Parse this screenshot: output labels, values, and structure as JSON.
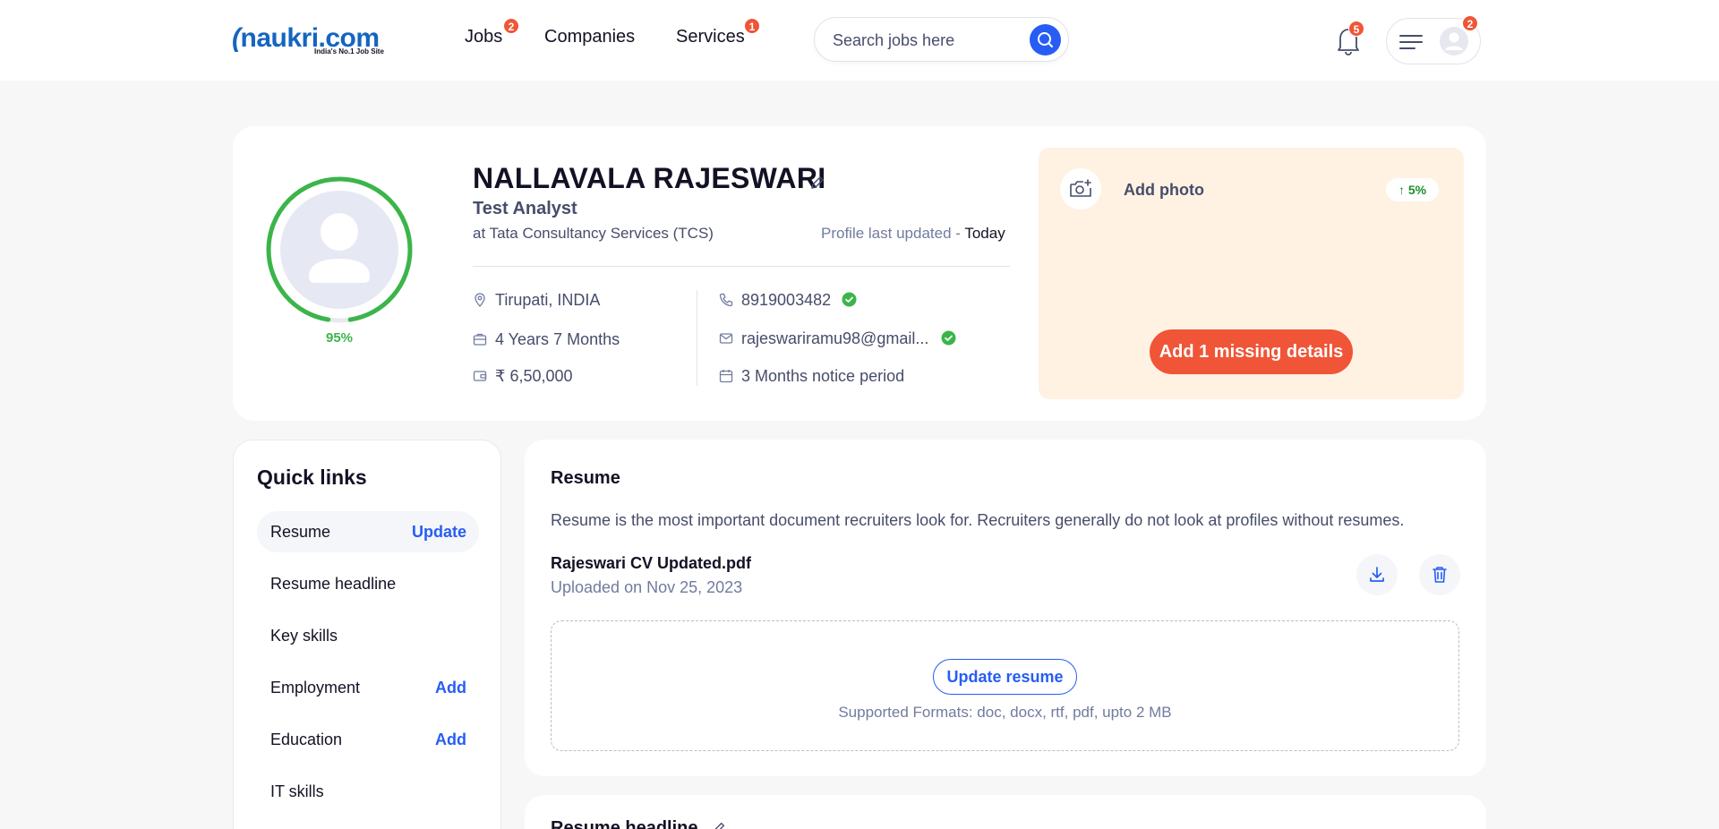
{
  "header": {
    "logo_text": "naukri",
    "logo_suffix": ".com",
    "logo_tagline": "India's No.1 Job Site",
    "nav": [
      {
        "label": "Jobs",
        "badge": "2"
      },
      {
        "label": "Companies",
        "badge": ""
      },
      {
        "label": "Services",
        "badge": "1"
      }
    ],
    "search_placeholder": "Search jobs here",
    "notification_badge": "5",
    "menu_badge": "2"
  },
  "profile": {
    "completion": "95%",
    "completion_value": 95,
    "name": "NALLAVALA RAJESWARI",
    "title": "Test Analyst",
    "company": "at Tata Consultancy Services (TCS)",
    "updated_label": "Profile last updated - ",
    "updated_value": "Today",
    "location": "Tirupati, INDIA",
    "experience": "4 Years 7 Months",
    "salary": "₹ 6,50,000",
    "phone": "8919003482",
    "email": "rajeswariramu98@gmail...",
    "notice": "3 Months notice period"
  },
  "missing": {
    "add_photo": "Add photo",
    "boost": "5%",
    "button": "Add 1 missing details"
  },
  "quick_links": {
    "title": "Quick links",
    "items": [
      {
        "label": "Resume",
        "action": "Update"
      },
      {
        "label": "Resume headline",
        "action": ""
      },
      {
        "label": "Key skills",
        "action": ""
      },
      {
        "label": "Employment",
        "action": "Add"
      },
      {
        "label": "Education",
        "action": "Add"
      },
      {
        "label": "IT skills",
        "action": ""
      }
    ]
  },
  "resume": {
    "title": "Resume",
    "description": "Resume is the most important document recruiters look for. Recruiters generally do not look at profiles without resumes.",
    "file_name": "Rajeswari CV Updated.pdf",
    "uploaded": "Uploaded on Nov 25, 2023",
    "update_button": "Update resume",
    "formats": "Supported Formats: doc, docx, rtf, pdf, upto 2 MB"
  },
  "next_section": {
    "title": "Resume headline"
  },
  "colors": {
    "brand_blue": "#275df5",
    "accent_orange": "#f05537",
    "success_green": "#3bb54a",
    "missing_bg": "#fff2e3"
  }
}
